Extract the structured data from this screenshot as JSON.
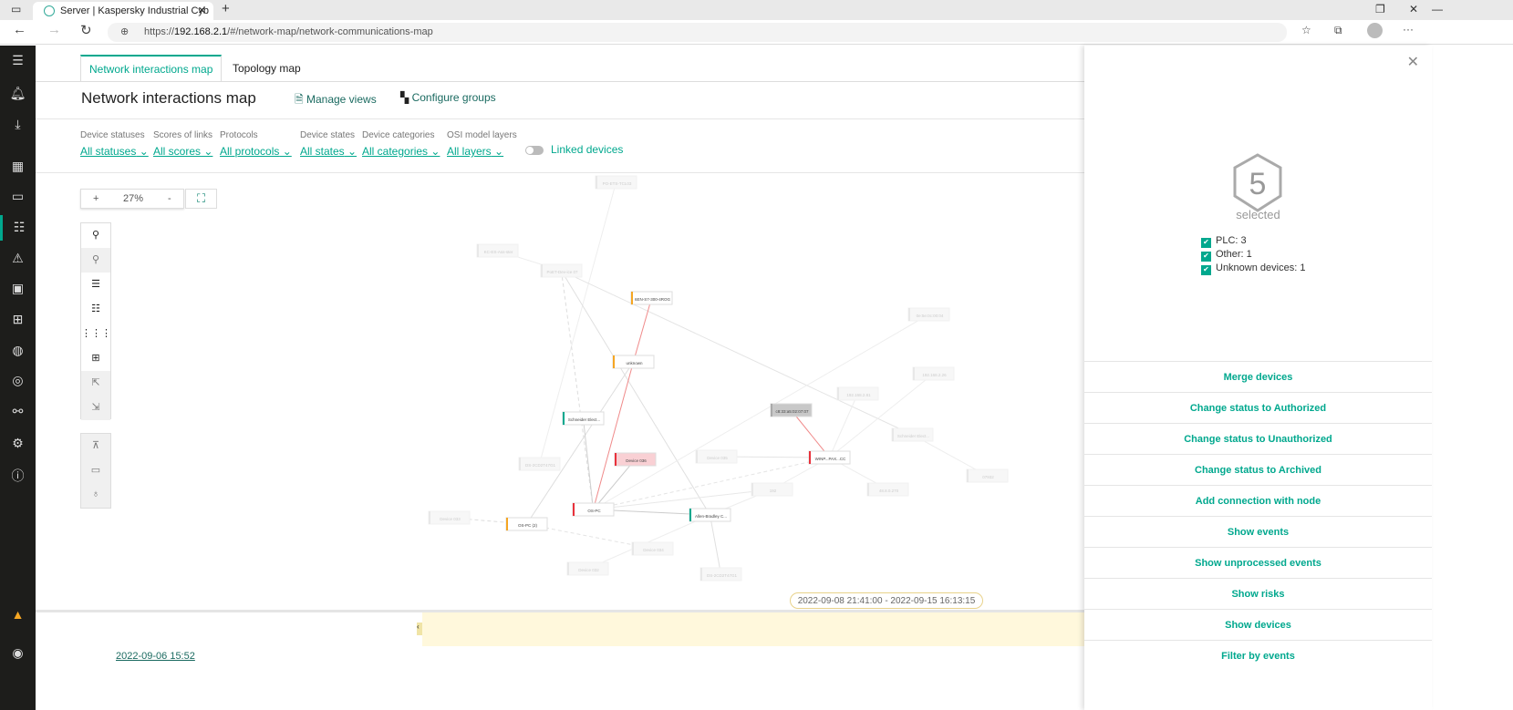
{
  "browser": {
    "tab_title": "Server | Kaspersky Industrial Cyb",
    "url_prefix": "https://",
    "url_host": "192.168.2.1",
    "url_path": "/#/network-map/network-communications-map"
  },
  "tabs": [
    {
      "label": "Network interactions map"
    },
    {
      "label": "Topology map"
    }
  ],
  "header": {
    "title": "Network interactions map",
    "manage_views": "Manage views",
    "configure_groups": "Configure groups"
  },
  "filters": [
    {
      "label": "Device statuses",
      "value": "All statuses"
    },
    {
      "label": "Scores of links",
      "value": "All scores"
    },
    {
      "label": "Protocols",
      "value": "All protocols"
    },
    {
      "label": "Device states",
      "value": "All states"
    },
    {
      "label": "Device categories",
      "value": "All categories"
    },
    {
      "label": "OSI model layers",
      "value": "All layers"
    }
  ],
  "linked_devices": {
    "label": "Linked devices",
    "on": false
  },
  "zoom": {
    "plus": "+",
    "value": "27%",
    "minus": "-"
  },
  "map": {
    "nodes": [
      {
        "label": "PO-ETS-TCL03"
      },
      {
        "label": "KC-ES-Ass-ster"
      },
      {
        "label": "PoET-Dev-ice 07"
      },
      {
        "label": "6EN-S7-300-4ROG"
      },
      {
        "label": "0e:5e:0c:00:04"
      },
      {
        "label": "unknown"
      },
      {
        "label": "192.168.2.26"
      },
      {
        "label": "192.168.2.81"
      },
      {
        "label": "c8:33:a5:02:07:07"
      },
      {
        "label": "Schneider Elect..."
      },
      {
        "label": "Schneider Elect..."
      },
      {
        "label": "Device 036"
      },
      {
        "label": "Device 035"
      },
      {
        "label": "WINP...PAX...CC"
      },
      {
        "label": "DS-2CD2T47G1"
      },
      {
        "label": "07932"
      },
      {
        "label": "192"
      },
      {
        "label": "48.8.0.270"
      },
      {
        "label": "OS-PC"
      },
      {
        "label": "Allen-Bradley C..."
      },
      {
        "label": "Device 033"
      },
      {
        "label": "OS-PC (2)"
      },
      {
        "label": "Device 034"
      },
      {
        "label": "Device 032"
      },
      {
        "label": "DS-2CD2T47G1"
      }
    ],
    "status_colors": {
      "orange": "#f5a623",
      "red": "#e8313b",
      "teal": "#00a88e"
    }
  },
  "period": "2022-09-08 21:41:00 - 2022-09-15 16:13:15",
  "timeline_start": "2022-09-06 15:52",
  "panel": {
    "count": "5",
    "selected_label": "selected",
    "categories": [
      {
        "label": "PLC: 3",
        "checked": true
      },
      {
        "label": "Other: 1",
        "checked": true
      },
      {
        "label": "Unknown devices: 1",
        "checked": true
      }
    ],
    "actions": [
      "Merge devices",
      "Change status to Authorized",
      "Change status to Unauthorized",
      "Change status to Archived",
      "Add connection with node",
      "Show events",
      "Show unprocessed events",
      "Show risks",
      "Show devices",
      "Filter by events"
    ]
  }
}
